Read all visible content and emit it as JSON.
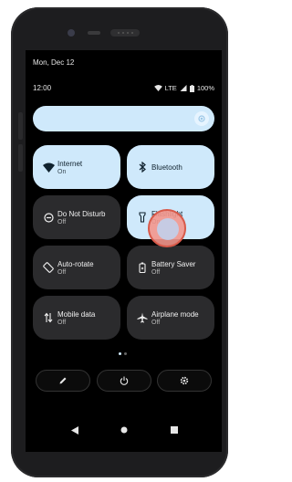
{
  "header": {
    "date": "Mon, Dec 12",
    "time": "12:00",
    "network": "LTE",
    "battery": "100%"
  },
  "tiles": [
    {
      "title": "Internet",
      "subtitle": "On",
      "state": "on",
      "icon": "wifi-icon"
    },
    {
      "title": "Bluetooth",
      "subtitle": "",
      "state": "on",
      "icon": "bluetooth-icon"
    },
    {
      "title": "Do Not Disturb",
      "subtitle": "Off",
      "state": "off",
      "icon": "do-not-disturb-icon"
    },
    {
      "title": "Flashlight",
      "subtitle": "On",
      "state": "on",
      "icon": "flashlight-icon"
    },
    {
      "title": "Auto-rotate",
      "subtitle": "Off",
      "state": "off",
      "icon": "auto-rotate-icon"
    },
    {
      "title": "Battery Saver",
      "subtitle": "Off",
      "state": "off",
      "icon": "battery-saver-icon"
    },
    {
      "title": "Mobile data",
      "subtitle": "Off",
      "state": "off",
      "icon": "mobile-data-icon"
    },
    {
      "title": "Airplane mode",
      "subtitle": "Off",
      "state": "off",
      "icon": "airplane-icon"
    }
  ],
  "page_dots": {
    "count": 2,
    "active": 0
  },
  "footer_buttons": [
    "edit-icon",
    "power-icon",
    "settings-icon"
  ],
  "nav_buttons": [
    "back-icon",
    "home-icon",
    "recents-icon"
  ],
  "colors": {
    "tile_on": "#cfe9fb",
    "tile_off": "#2b2b2d",
    "screen_bg": "#000000",
    "touch_indicator": "#f3968c"
  }
}
